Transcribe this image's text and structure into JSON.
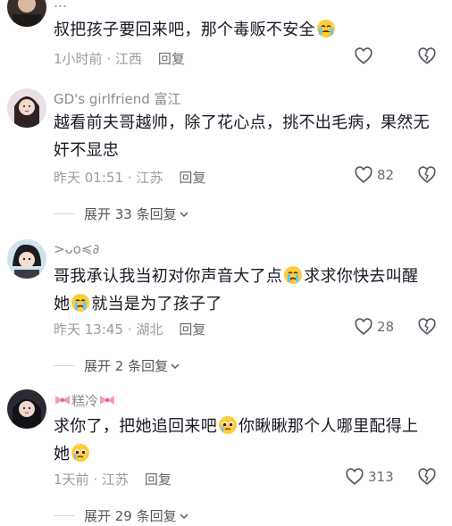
{
  "comments": [
    {
      "username": "…",
      "text": "叔把孩子要回来吧，那个毒贩不安全",
      "emoji_after": "crying-face",
      "time": "1小时前",
      "location": "江西",
      "reply_label": "回复",
      "likes": ""
    },
    {
      "username": "GD's girlfriend 富江",
      "text_line1": "越看前夫哥越帅，除了花心点，挑不出毛病，果然无",
      "text_line2": "奸不显忠",
      "time": "昨天 01:51",
      "location": "江苏",
      "reply_label": "回复",
      "likes": "82",
      "expand_label": "展开 33 条回复"
    },
    {
      "username": ">ᴗo≼∂",
      "text_line1a": "哥我承认我当初对你声音大了点",
      "text_line1b": "求求你快去叫醒",
      "text_line2a": "她",
      "text_line2b": "就当是为了孩子了",
      "time": "昨天 13:45",
      "location": "湖北",
      "reply_label": "回复",
      "likes": "28",
      "expand_label": "展开 2 条回复"
    },
    {
      "username": "糕冷",
      "text_line1a": "求你了，把她追回来吧",
      "text_line1b": "你瞅瞅那个人哪里配得上",
      "text_line2a": "她",
      "time": "1天前",
      "location": "江苏",
      "reply_label": "回复",
      "likes": "313",
      "expand_label": "展开 29 条回复"
    }
  ],
  "separator": " · ",
  "colors": {
    "text": "#161823",
    "meta": "#9a9ba1",
    "username": "#8a8b91"
  },
  "icons": {
    "like": "heart-outline-icon",
    "dislike": "broken-heart-icon",
    "expand": "chevron-down-icon"
  }
}
